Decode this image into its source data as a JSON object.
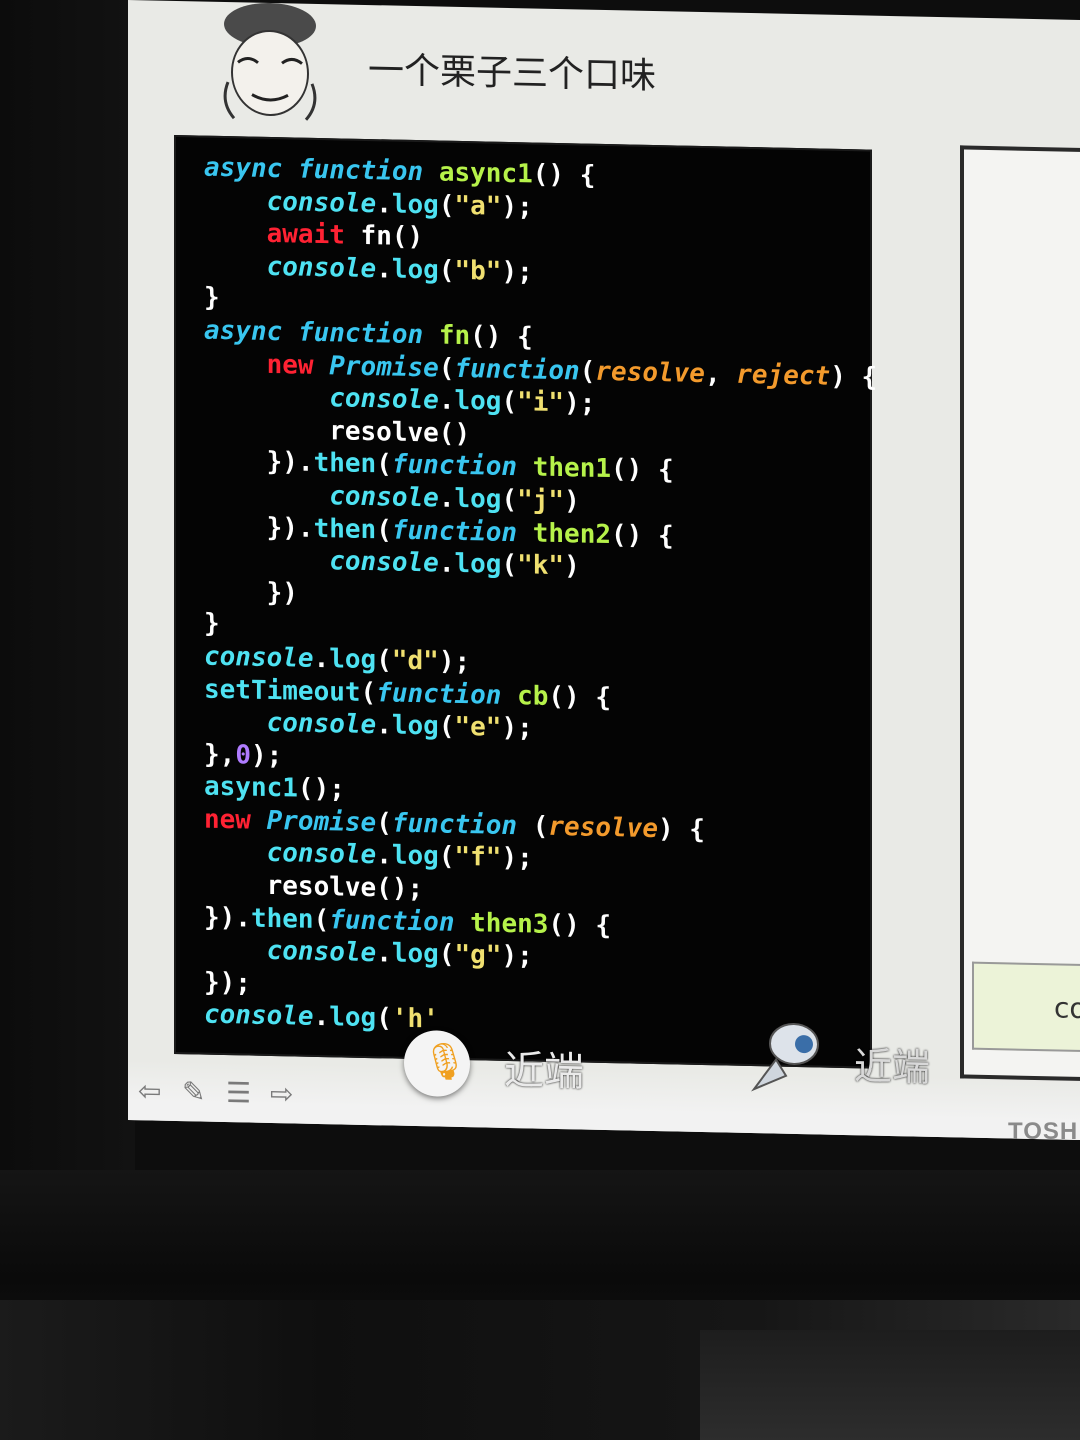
{
  "slide": {
    "title": "一个栗子三个口味"
  },
  "code_lines": [
    [
      [
        "kw",
        "async"
      ],
      [
        "pl",
        " "
      ],
      [
        "fnk",
        "function"
      ],
      [
        "pl",
        " "
      ],
      [
        "name",
        "async1"
      ],
      [
        "pl",
        "() {"
      ]
    ],
    [
      [
        "pl",
        "    "
      ],
      [
        "cons",
        "console"
      ],
      [
        "pl",
        "."
      ],
      [
        "meth",
        "log"
      ],
      [
        "pl",
        "("
      ],
      [
        "str",
        "\"a\""
      ],
      [
        "pl",
        ");"
      ]
    ],
    [
      [
        "pl",
        "    "
      ],
      [
        "nw",
        "await"
      ],
      [
        "pl",
        " fn()"
      ]
    ],
    [
      [
        "pl",
        "    "
      ],
      [
        "cons",
        "console"
      ],
      [
        "pl",
        "."
      ],
      [
        "meth",
        "log"
      ],
      [
        "pl",
        "("
      ],
      [
        "str",
        "\"b\""
      ],
      [
        "pl",
        ");"
      ]
    ],
    [
      [
        "pl",
        "}"
      ]
    ],
    [
      [
        "kw",
        "async"
      ],
      [
        "pl",
        " "
      ],
      [
        "fnk",
        "function"
      ],
      [
        "pl",
        " "
      ],
      [
        "name",
        "fn"
      ],
      [
        "pl",
        "() {"
      ]
    ],
    [
      [
        "pl",
        "    "
      ],
      [
        "nw",
        "new"
      ],
      [
        "pl",
        " "
      ],
      [
        "cls",
        "Promise"
      ],
      [
        "pl",
        "("
      ],
      [
        "fnk",
        "function"
      ],
      [
        "pl",
        "("
      ],
      [
        "param",
        "resolve"
      ],
      [
        "pl",
        ", "
      ],
      [
        "param",
        "reject"
      ],
      [
        "pl",
        ") {"
      ]
    ],
    [
      [
        "pl",
        "        "
      ],
      [
        "cons",
        "console"
      ],
      [
        "pl",
        "."
      ],
      [
        "meth",
        "log"
      ],
      [
        "pl",
        "("
      ],
      [
        "str",
        "\"i\""
      ],
      [
        "pl",
        ");"
      ]
    ],
    [
      [
        "pl",
        "        resolve()"
      ]
    ],
    [
      [
        "pl",
        "    })."
      ],
      [
        "meth",
        "then"
      ],
      [
        "pl",
        "("
      ],
      [
        "fnk",
        "function"
      ],
      [
        "pl",
        " "
      ],
      [
        "name",
        "then1"
      ],
      [
        "pl",
        "() {"
      ]
    ],
    [
      [
        "pl",
        "        "
      ],
      [
        "cons",
        "console"
      ],
      [
        "pl",
        "."
      ],
      [
        "meth",
        "log"
      ],
      [
        "pl",
        "("
      ],
      [
        "str",
        "\"j\""
      ],
      [
        "pl",
        ")"
      ]
    ],
    [
      [
        "pl",
        "    })."
      ],
      [
        "meth",
        "then"
      ],
      [
        "pl",
        "("
      ],
      [
        "fnk",
        "function"
      ],
      [
        "pl",
        " "
      ],
      [
        "name",
        "then2"
      ],
      [
        "pl",
        "() {"
      ]
    ],
    [
      [
        "pl",
        "        "
      ],
      [
        "cons",
        "console"
      ],
      [
        "pl",
        "."
      ],
      [
        "meth",
        "log"
      ],
      [
        "pl",
        "("
      ],
      [
        "str",
        "\"k\""
      ],
      [
        "pl",
        ")"
      ]
    ],
    [
      [
        "pl",
        "    })"
      ]
    ],
    [
      [
        "pl",
        "}"
      ]
    ],
    [
      [
        "cons",
        "console"
      ],
      [
        "pl",
        "."
      ],
      [
        "meth",
        "log"
      ],
      [
        "pl",
        "("
      ],
      [
        "str",
        "\"d\""
      ],
      [
        "pl",
        ");"
      ]
    ],
    [
      [
        "meth",
        "setTimeout"
      ],
      [
        "pl",
        "("
      ],
      [
        "fnk",
        "function"
      ],
      [
        "pl",
        " "
      ],
      [
        "name",
        "cb"
      ],
      [
        "pl",
        "() {"
      ]
    ],
    [
      [
        "pl",
        "    "
      ],
      [
        "cons",
        "console"
      ],
      [
        "pl",
        "."
      ],
      [
        "meth",
        "log"
      ],
      [
        "pl",
        "("
      ],
      [
        "str",
        "\"e\""
      ],
      [
        "pl",
        ");"
      ]
    ],
    [
      [
        "pl",
        "},"
      ],
      [
        "num",
        "0"
      ],
      [
        "pl",
        ");"
      ]
    ],
    [
      [
        "meth",
        "async1"
      ],
      [
        "pl",
        "();"
      ]
    ],
    [
      [
        "nw",
        "new"
      ],
      [
        "pl",
        " "
      ],
      [
        "cls",
        "Promise"
      ],
      [
        "pl",
        "("
      ],
      [
        "fnk",
        "function"
      ],
      [
        "pl",
        " ("
      ],
      [
        "param",
        "resolve"
      ],
      [
        "pl",
        ") {"
      ]
    ],
    [
      [
        "pl",
        "    "
      ],
      [
        "cons",
        "console"
      ],
      [
        "pl",
        "."
      ],
      [
        "meth",
        "log"
      ],
      [
        "pl",
        "("
      ],
      [
        "str",
        "\"f\""
      ],
      [
        "pl",
        ");"
      ]
    ],
    [
      [
        "pl",
        "    resolve();"
      ]
    ],
    [
      [
        "pl",
        "})."
      ],
      [
        "meth",
        "then"
      ],
      [
        "pl",
        "("
      ],
      [
        "fnk",
        "function"
      ],
      [
        "pl",
        " "
      ],
      [
        "name",
        "then3"
      ],
      [
        "pl",
        "() {"
      ]
    ],
    [
      [
        "pl",
        "    "
      ],
      [
        "cons",
        "console"
      ],
      [
        "pl",
        "."
      ],
      [
        "meth",
        "log"
      ],
      [
        "pl",
        "("
      ],
      [
        "str",
        "\"g\""
      ],
      [
        "pl",
        ");"
      ]
    ],
    [
      [
        "pl",
        "});"
      ]
    ],
    [
      [
        "cons",
        "console"
      ],
      [
        "pl",
        "."
      ],
      [
        "meth",
        "log"
      ],
      [
        "pl",
        "("
      ],
      [
        "str",
        "'h'"
      ]
    ]
  ],
  "right_panel": {
    "card_text": "co"
  },
  "controls": {
    "near_end_mic_label": "近端",
    "near_end_camera_label": "近端"
  },
  "monitor": {
    "brand": "TOSH"
  },
  "colors": {
    "keyword": "#39c6f0",
    "new_await": "#ff2233",
    "function_name": "#b6f24a",
    "string": "#f0e070",
    "param": "#f39a2c",
    "number": "#b07cff"
  },
  "icons": {
    "toolbar": [
      "back-arrow-icon",
      "pen-icon",
      "list-icon",
      "forward-arrow-icon"
    ],
    "mic": "mic-muted-icon",
    "camera": "camera-icon"
  }
}
